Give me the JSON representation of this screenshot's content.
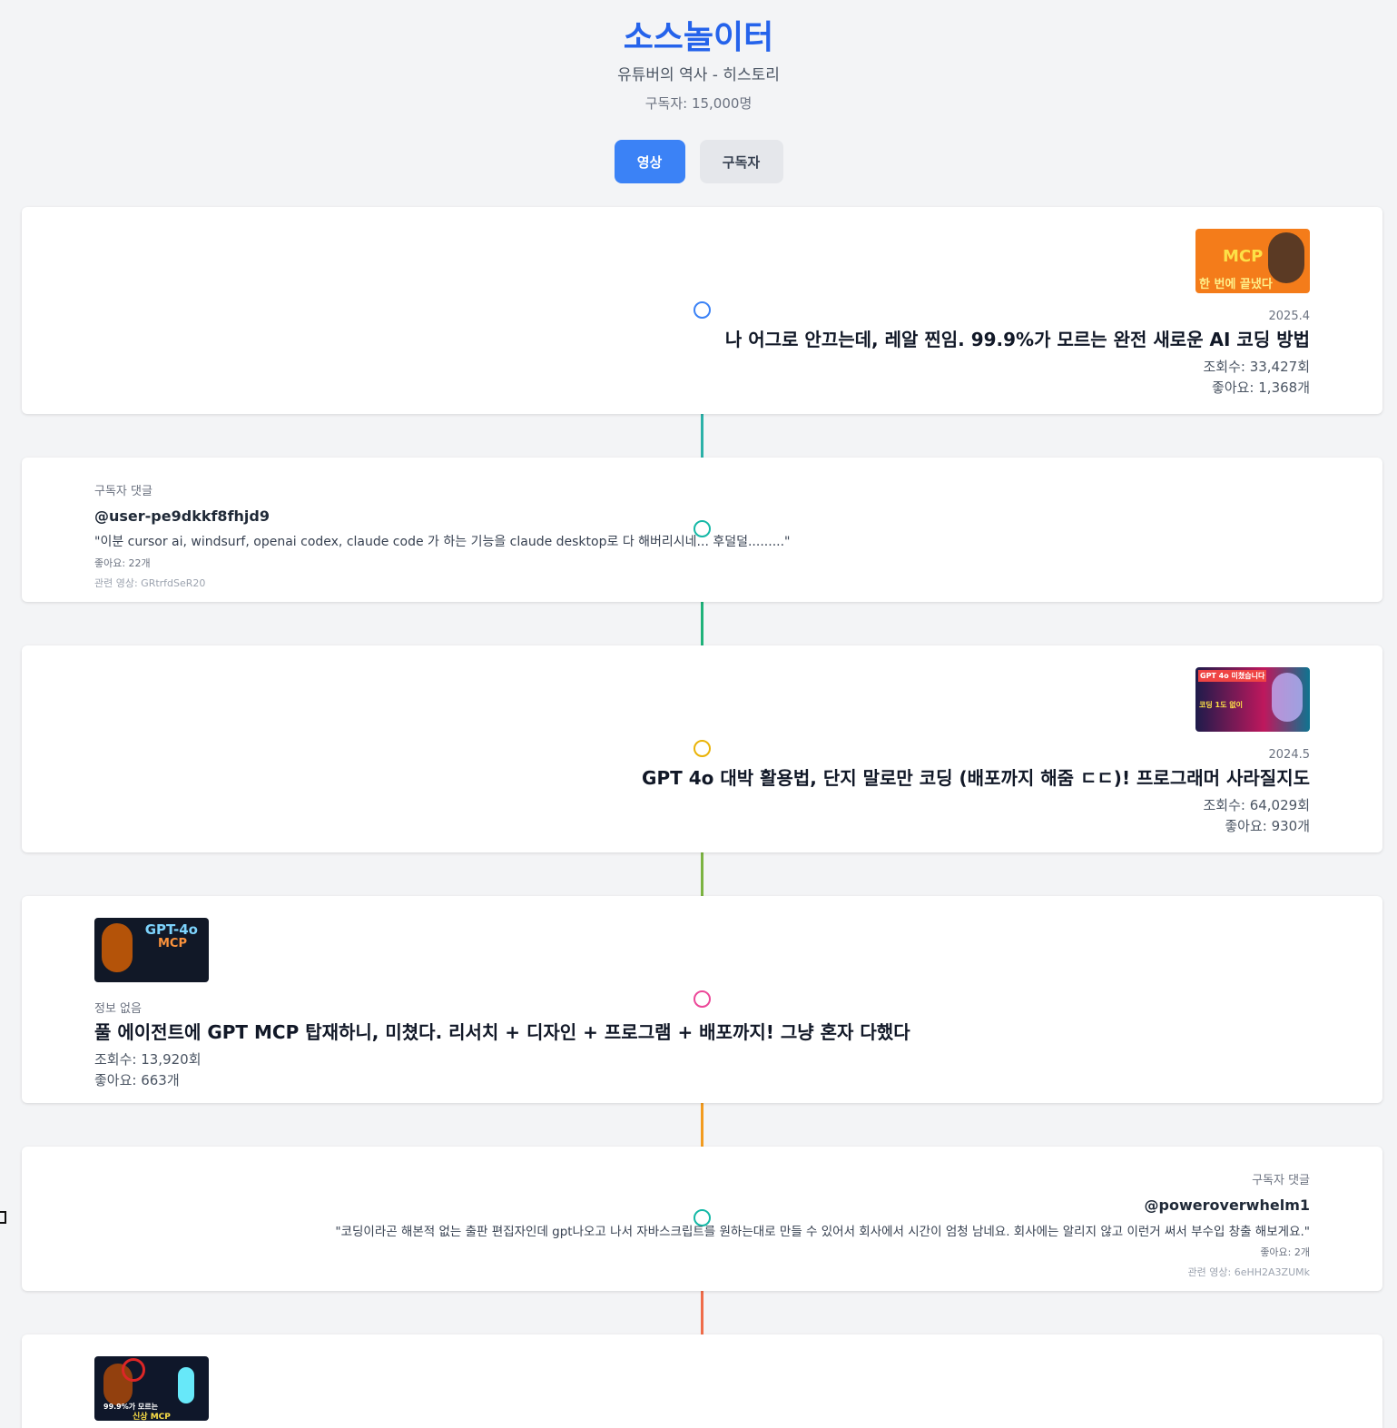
{
  "header": {
    "title": "소스놀이터",
    "subtitle": "유튜버의 역사 - 히스토리",
    "subscribers": "구독자: 15,000명"
  },
  "tabs": [
    {
      "label": "영상",
      "active": true
    },
    {
      "label": "구독자",
      "active": false
    }
  ],
  "items": [
    {
      "type": "video",
      "date": "2025.4",
      "title": "나 어그로 안끄는데, 레알 찐임. 99.9%가 모르는 완전 새로운 AI 코딩 방법",
      "views": "조회수: 33,427회",
      "likes": "좋아요: 1,368개",
      "thumb_text_1": "MCP",
      "thumb_text_2": "한 번에 끝냈다",
      "dot_color": "#3b82f6"
    },
    {
      "type": "comment",
      "label": "구독자 댓글",
      "user": "@user-pe9dkkf8fhjd9",
      "text": "\"이분 cursor ai, windsurf, openai codex, claude code 가 하는 기능을 claude desktop로 다 해버리시네... 후덜덜.........\"",
      "likes": "좋아요: 22개",
      "related": "관련 영상: GRtrfdSeR20",
      "dot_color": "#14b8a6"
    },
    {
      "type": "video",
      "date": "2024.5",
      "title": "GPT 4o 대박 활용법, 단지 말로만 코딩 (배포까지 해줌 ㄷㄷ)! 프로그래머 사라질지도",
      "views": "조회수: 64,029회",
      "likes": "좋아요: 930개",
      "thumb_text_1": "GPT 4o 미쳤습니다",
      "thumb_text_2": "코딩 1도 없이",
      "dot_color": "#eab308"
    },
    {
      "type": "video",
      "date": "정보 없음",
      "title": "풀 에이전트에 GPT MCP 탑재하니, 미쳤다. 리서치 + 디자인 + 프로그램 + 배포까지! 그냥 혼자 다했다",
      "views": "조회수: 13,920회",
      "likes": "좋아요: 663개",
      "thumb_text_1": "GPT-4o",
      "thumb_text_2": "MCP",
      "dot_color": "#ec4899"
    },
    {
      "type": "comment",
      "label": "구독자 댓글",
      "user": "@poweroverwhelm1",
      "text": "\"코딩이라곤 해본적 없는 출판 편집자인데 gpt나오고 나서 자바스크립트를 원하는대로 만들 수 있어서 회사에서 시간이 엄청 남네요. 회사에는 알리지 않고 이런거 써서 부수입 창출 해보게요.\"",
      "likes": "좋아요: 2개",
      "related": "관련 영상: 6eHH2A3ZUMk",
      "dot_color": "#14b8a6"
    },
    {
      "type": "video",
      "thumb_text_1": "99.9%가 모르는",
      "thumb_text_2": "신상 MCP"
    }
  ],
  "connector_colors": [
    "#2bb1a8",
    "#1fb27a",
    "#7cb342",
    "#f29b1f",
    "#ef6c4a"
  ]
}
